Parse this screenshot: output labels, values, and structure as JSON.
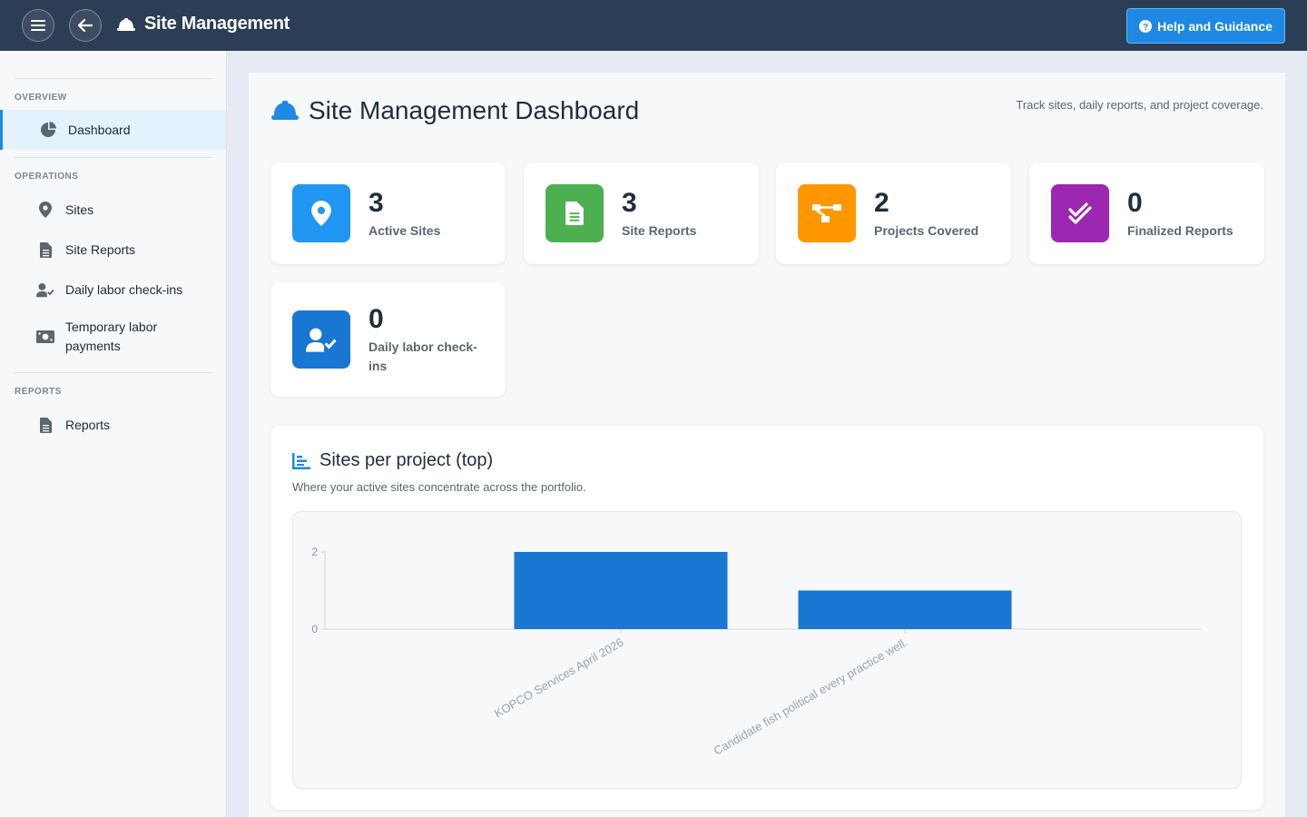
{
  "header": {
    "app_title": "Site Management",
    "help_label": "Help and Guidance"
  },
  "sidebar": {
    "sections": [
      {
        "label": "OVERVIEW",
        "items": [
          {
            "label": "Dashboard",
            "icon": "pie-chart-icon",
            "active": true
          }
        ]
      },
      {
        "label": "OPERATIONS",
        "items": [
          {
            "label": "Sites",
            "icon": "map-pin-icon"
          },
          {
            "label": "Site Reports",
            "icon": "document-icon"
          },
          {
            "label": "Daily labor check-ins",
            "icon": "user-check-icon"
          },
          {
            "label": "Temporary labor payments",
            "icon": "money-icon"
          }
        ]
      },
      {
        "label": "REPORTS",
        "items": [
          {
            "label": "Reports",
            "icon": "document-icon"
          }
        ]
      }
    ]
  },
  "page": {
    "title": "Site Management Dashboard",
    "subtitle": "Track sites, daily reports, and project coverage."
  },
  "stats": [
    {
      "value": "3",
      "label": "Active Sites",
      "color": "#2196f3",
      "icon": "map-pin-icon"
    },
    {
      "value": "3",
      "label": "Site Reports",
      "color": "#4caf50",
      "icon": "document-icon"
    },
    {
      "value": "2",
      "label": "Projects Covered",
      "color": "#ff9800",
      "icon": "project-diagram-icon"
    },
    {
      "value": "0",
      "label": "Finalized Reports",
      "color": "#9c27b0",
      "icon": "double-check-icon"
    },
    {
      "value": "0",
      "label": "Daily labor check-ins",
      "color": "#1976d2",
      "icon": "user-check-icon"
    }
  ],
  "chart_section": {
    "title": "Sites per project (top)",
    "description": "Where your active sites concentrate across the portfolio."
  },
  "chart_data": {
    "type": "bar",
    "categories": [
      "KOPCO Services April 2026",
      "Candidate fish political every practice well."
    ],
    "values": [
      2,
      1
    ],
    "ylim": [
      0,
      2
    ],
    "yticks": [
      0,
      2
    ],
    "bar_color": "#1976d2",
    "grid": false,
    "xlabel": "",
    "ylabel": ""
  }
}
